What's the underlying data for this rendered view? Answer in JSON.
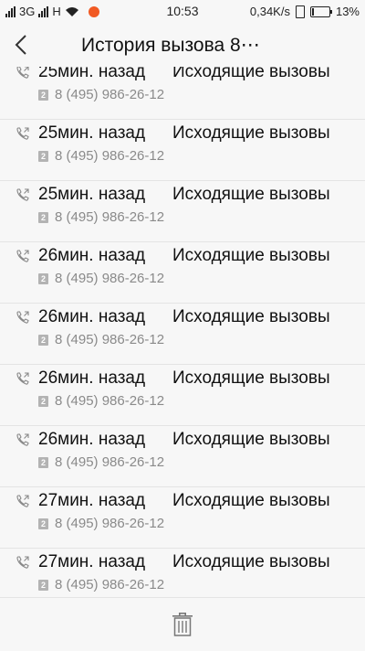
{
  "status": {
    "network_type": "3G",
    "network_type2": "H",
    "time": "10:53",
    "speed": "0,34K/s",
    "battery": "13%",
    "battery_level": 0.13,
    "icons": [
      "signal-icon",
      "wifi-icon",
      "app-notification-icon",
      "vibrate-icon",
      "battery-icon"
    ]
  },
  "header": {
    "title": "История вызова 8⋯",
    "back_icon": "back-arrow-icon"
  },
  "calls": [
    {
      "time": "25мин. назад",
      "type": "Исходящие вызовы",
      "sim": "2",
      "number": "8 (495) 986-26-12"
    },
    {
      "time": "25мин. назад",
      "type": "Исходящие вызовы",
      "sim": "2",
      "number": "8 (495) 986-26-12"
    },
    {
      "time": "25мин. назад",
      "type": "Исходящие вызовы",
      "sim": "2",
      "number": "8 (495) 986-26-12"
    },
    {
      "time": "26мин. назад",
      "type": "Исходящие вызовы",
      "sim": "2",
      "number": "8 (495) 986-26-12"
    },
    {
      "time": "26мин. назад",
      "type": "Исходящие вызовы",
      "sim": "2",
      "number": "8 (495) 986-26-12"
    },
    {
      "time": "26мин. назад",
      "type": "Исходящие вызовы",
      "sim": "2",
      "number": "8 (495) 986-26-12"
    },
    {
      "time": "26мин. назад",
      "type": "Исходящие вызовы",
      "sim": "2",
      "number": "8 (495) 986-26-12"
    },
    {
      "time": "27мин. назад",
      "type": "Исходящие вызовы",
      "sim": "2",
      "number": "8 (495) 986-26-12"
    },
    {
      "time": "27мин. назад",
      "type": "Исходящие вызовы",
      "sim": "2",
      "number": "8 (495) 986-26-12"
    }
  ],
  "bottom": {
    "delete_icon": "trash-icon"
  },
  "colors": {
    "background": "#f7f7f7",
    "divider": "#e4e4e4",
    "secondary_text": "#8a8a8a",
    "sim_badge": "#b3b3b3",
    "app_dot": "#f15a24"
  }
}
